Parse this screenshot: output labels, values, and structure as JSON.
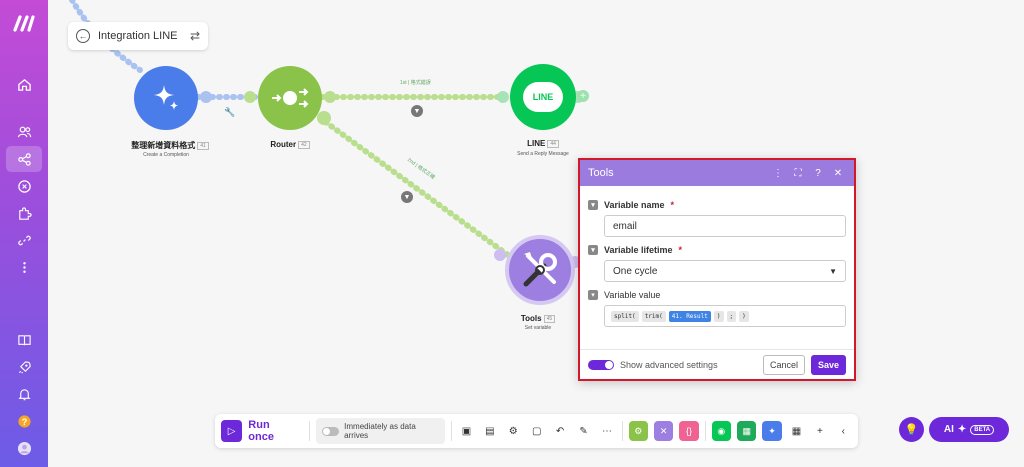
{
  "scenario": {
    "title": "Integration LINE"
  },
  "nodes": {
    "openai": {
      "label": "整理新增資料格式",
      "badge": "41",
      "sub": "Create a Completion",
      "color": "#4a7de9"
    },
    "router": {
      "label": "Router",
      "badge": "42",
      "color": "#8bc34a"
    },
    "line": {
      "label": "LINE",
      "badge": "44",
      "sub": "Send a Reply Message",
      "icon_text": "LINE",
      "color": "#06c755"
    },
    "tools": {
      "label": "Tools",
      "badge": "45",
      "sub": "Set variable",
      "color": "#9c7fe0"
    }
  },
  "routes": {
    "first": "1st",
    "first_label": "格式錯誤",
    "second": "2nd",
    "second_label": "格式正確"
  },
  "dialog": {
    "title": "Tools",
    "variable_name_label": "Variable name",
    "variable_name_value": "email",
    "variable_lifetime_label": "Variable lifetime",
    "variable_lifetime_value": "One cycle",
    "variable_value_label": "Variable value",
    "tokens": [
      "split(",
      "trim(",
      "41. Result",
      ")",
      ";",
      ")"
    ],
    "show_advanced_label": "Show advanced settings",
    "cancel_label": "Cancel",
    "save_label": "Save",
    "required_mark": "*"
  },
  "toolbar": {
    "run_label": "Run once",
    "schedule_label": "Immediately as data arrives"
  },
  "ai": {
    "label": "AI",
    "beta": "BETA"
  },
  "colors": {
    "brand": "#6d28d9",
    "highlight": "#d0182a"
  }
}
